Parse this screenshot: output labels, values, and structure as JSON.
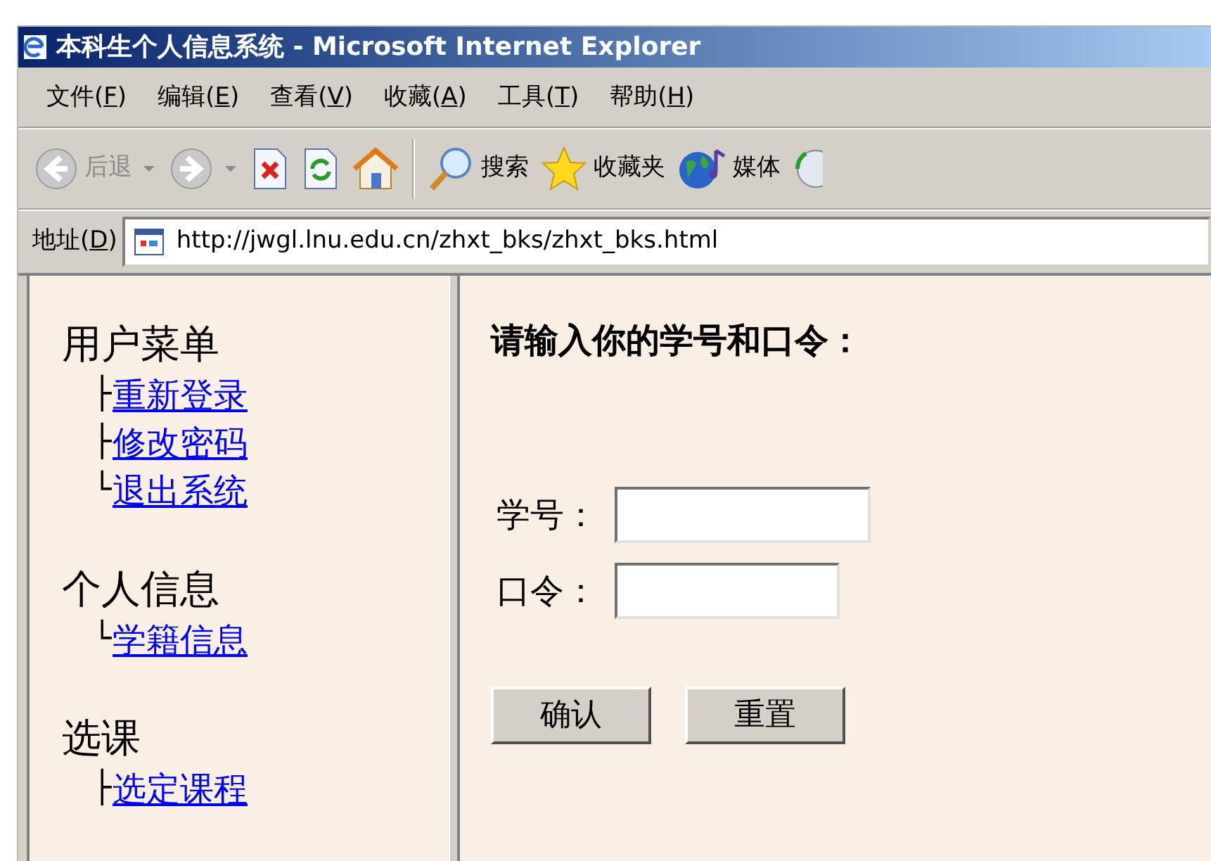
{
  "window": {
    "title": "本科生个人信息系统 - Microsoft Internet Explorer"
  },
  "menu": [
    {
      "before": "文件(",
      "key": "F",
      "after": ")"
    },
    {
      "before": "编辑(",
      "key": "E",
      "after": ")"
    },
    {
      "before": "查看(",
      "key": "V",
      "after": ")"
    },
    {
      "before": "收藏(",
      "key": "A",
      "after": ")"
    },
    {
      "before": "工具(",
      "key": "T",
      "after": ")"
    },
    {
      "before": "帮助(",
      "key": "H",
      "after": ")"
    }
  ],
  "toolbar": [
    {
      "kind": "back",
      "label": "后退",
      "disabled": true
    },
    {
      "kind": "forward",
      "disabled": true
    },
    {
      "kind": "stop"
    },
    {
      "kind": "refresh"
    },
    {
      "kind": "home"
    },
    {
      "kind": "separator"
    },
    {
      "kind": "search",
      "label": "搜索"
    },
    {
      "kind": "favorites",
      "label": "收藏夹"
    },
    {
      "kind": "media",
      "label": "媒体"
    },
    {
      "kind": "history"
    }
  ],
  "address": {
    "label_before": "地址(",
    "label_key": "D",
    "label_after": ")",
    "value": "http://jwgl.lnu.edu.cn/zhxt_bks/zhxt_bks.html"
  },
  "sidebar": {
    "sections": [
      {
        "title": "用户菜单",
        "children": [
          {
            "branch": "├",
            "label": "重新登录"
          },
          {
            "branch": "├",
            "label": "修改密码"
          },
          {
            "branch": "└",
            "label": "退出系统"
          }
        ]
      },
      {
        "title": "个人信息",
        "children": [
          {
            "branch": "└",
            "label": "学籍信息"
          }
        ]
      },
      {
        "title": "选课",
        "children": [
          {
            "branch": "├",
            "label": "选定课程"
          }
        ]
      }
    ]
  },
  "login": {
    "heading": "请输入你的学号和口令：",
    "fields": [
      {
        "label": "学号：",
        "kind": "text"
      },
      {
        "label": "口令：",
        "kind": "password"
      }
    ],
    "buttons": [
      "确认",
      "重置"
    ]
  }
}
